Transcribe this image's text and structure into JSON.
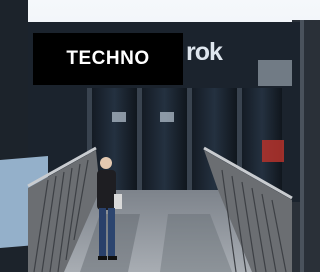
{
  "overlay": {
    "genre_label": "TECHNO"
  },
  "sign": {
    "logo_text": "rok"
  },
  "colors": {
    "sky": "#e9eef5",
    "glass": "#1a2430",
    "railing": "#6e6e6e",
    "deck": "#8a8f97"
  }
}
